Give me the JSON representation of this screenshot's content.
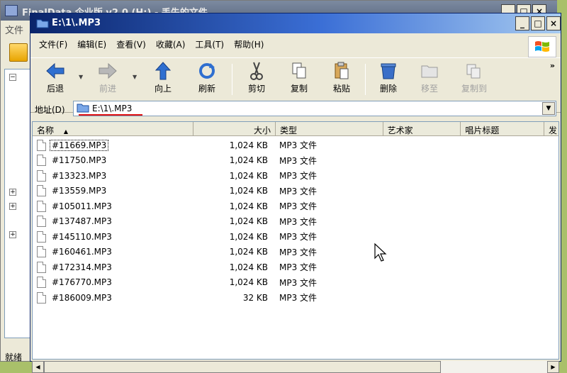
{
  "background_window": {
    "title": "FinalData 企业版 v2.0 (H:) - 丢失的文件",
    "menu_first": "文件",
    "status": "就绪",
    "buttons": {
      "minimize": "_",
      "maximize": "□",
      "close": "×"
    }
  },
  "window": {
    "title": "E:\\1\\.MP3",
    "buttons": {
      "minimize": "_",
      "maximize": "□",
      "close": "×"
    }
  },
  "menu": [
    {
      "label": "文件(F)"
    },
    {
      "label": "编辑(E)"
    },
    {
      "label": "查看(V)"
    },
    {
      "label": "收藏(A)"
    },
    {
      "label": "工具(T)"
    },
    {
      "label": "帮助(H)"
    }
  ],
  "toolbar": {
    "back": "后退",
    "forward": "前进",
    "up": "向上",
    "refresh": "刷新",
    "cut": "剪切",
    "copy": "复制",
    "paste": "粘贴",
    "delete": "删除",
    "move_to": "移至",
    "copy_to": "复制到",
    "more": "»"
  },
  "address": {
    "label": "地址(D)",
    "value": "E:\\1\\.MP3"
  },
  "columns": {
    "name": "名称",
    "size": "大小",
    "type": "类型",
    "artist": "艺术家",
    "album": "唱片标题",
    "extra": "发"
  },
  "files": [
    {
      "name": "#11669.MP3",
      "size": "1,024 KB",
      "type": "MP3 文件"
    },
    {
      "name": "#11750.MP3",
      "size": "1,024 KB",
      "type": "MP3 文件"
    },
    {
      "name": "#13323.MP3",
      "size": "1,024 KB",
      "type": "MP3 文件"
    },
    {
      "name": "#13559.MP3",
      "size": "1,024 KB",
      "type": "MP3 文件"
    },
    {
      "name": "#105011.MP3",
      "size": "1,024 KB",
      "type": "MP3 文件"
    },
    {
      "name": "#137487.MP3",
      "size": "1,024 KB",
      "type": "MP3 文件"
    },
    {
      "name": "#145110.MP3",
      "size": "1,024 KB",
      "type": "MP3 文件"
    },
    {
      "name": "#160461.MP3",
      "size": "1,024 KB",
      "type": "MP3 文件"
    },
    {
      "name": "#172314.MP3",
      "size": "1,024 KB",
      "type": "MP3 文件"
    },
    {
      "name": "#176770.MP3",
      "size": "1,024 KB",
      "type": "MP3 文件"
    },
    {
      "name": "#186009.MP3",
      "size": "32 KB",
      "type": "MP3 文件"
    }
  ],
  "colors": {
    "titlebar_start": "#0a246a",
    "titlebar_end": "#a6caf0",
    "address_underline": "#e01010"
  }
}
